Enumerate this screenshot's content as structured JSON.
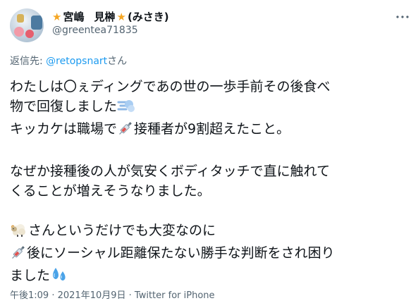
{
  "user": {
    "name_part1": "宮嶋",
    "name_part2": "見榊",
    "name_part3": "(みさき)",
    "handle": "@greentea71835"
  },
  "reply": {
    "prefix": "返信先: ",
    "mention": "@retopsnart",
    "suffix": "さん"
  },
  "tweet": {
    "line1": "わたしは〇ぇディングであの世の一歩手前その後食べ",
    "line2": "物で回復しました",
    "line3a": "キッカケは職場で",
    "line3b": "接種者が9割超えたこと。",
    "line4": "なぜか接種後の人が気安くボディタッチで直に触れて",
    "line5": "くることが増えそうなりました。",
    "line6": "さんというだけでも大変なのに",
    "line7": "後にソーシャル距離保たない勝手な判断をされ困り",
    "line8": "ました"
  },
  "meta": {
    "time": "午後1:09",
    "sep1": " · ",
    "date": "2021年10月9日",
    "sep2": " · ",
    "source": "Twitter for iPhone"
  },
  "icons": {
    "more": "more-icon",
    "star": "star-icon",
    "dash": "dash-icon",
    "syringe": "syringe-icon",
    "sheep": "sheep-icon",
    "sweat": "sweat-droplets-icon"
  },
  "colors": {
    "text": "#0f1419",
    "secondary": "#536471",
    "link": "#1d9bf0",
    "star": "#f5a623"
  }
}
